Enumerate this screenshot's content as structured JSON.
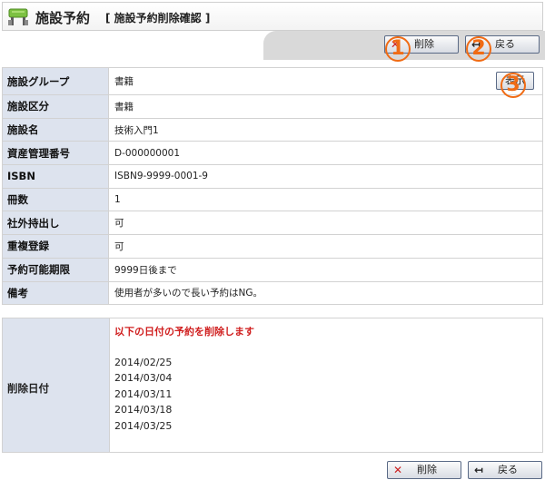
{
  "header": {
    "title": "施設予約",
    "subtitle": "[ 施設予約削除確認 ]"
  },
  "toolbar": {
    "delete_label": "削除",
    "back_label": "戻る"
  },
  "markers": [
    "1",
    "2",
    "3"
  ],
  "details": [
    {
      "label": "施設グループ",
      "value": "書籍"
    },
    {
      "label": "施設区分",
      "value": "書籍"
    },
    {
      "label": "施設名",
      "value": "技術入門1"
    },
    {
      "label": "資産管理番号",
      "value": "D-000000001"
    },
    {
      "label": "ISBN",
      "value": "ISBN9-9999-0001-9"
    },
    {
      "label": "冊数",
      "value": "1"
    },
    {
      "label": "社外持出し",
      "value": "可"
    },
    {
      "label": "重複登録",
      "value": "可"
    },
    {
      "label": "予約可能期限",
      "value": "9999日後まで"
    },
    {
      "label": "備考",
      "value": "使用者が多いので長い予約はNG。"
    }
  ],
  "show_button_label": "表示",
  "deletion": {
    "label": "削除日付",
    "warning": "以下の日付の予約を削除します",
    "dates": [
      "2014/02/25",
      "2014/03/04",
      "2014/03/11",
      "2014/03/18",
      "2014/03/25"
    ]
  },
  "bottom_toolbar": {
    "delete_label": "削除",
    "back_label": "戻る"
  }
}
